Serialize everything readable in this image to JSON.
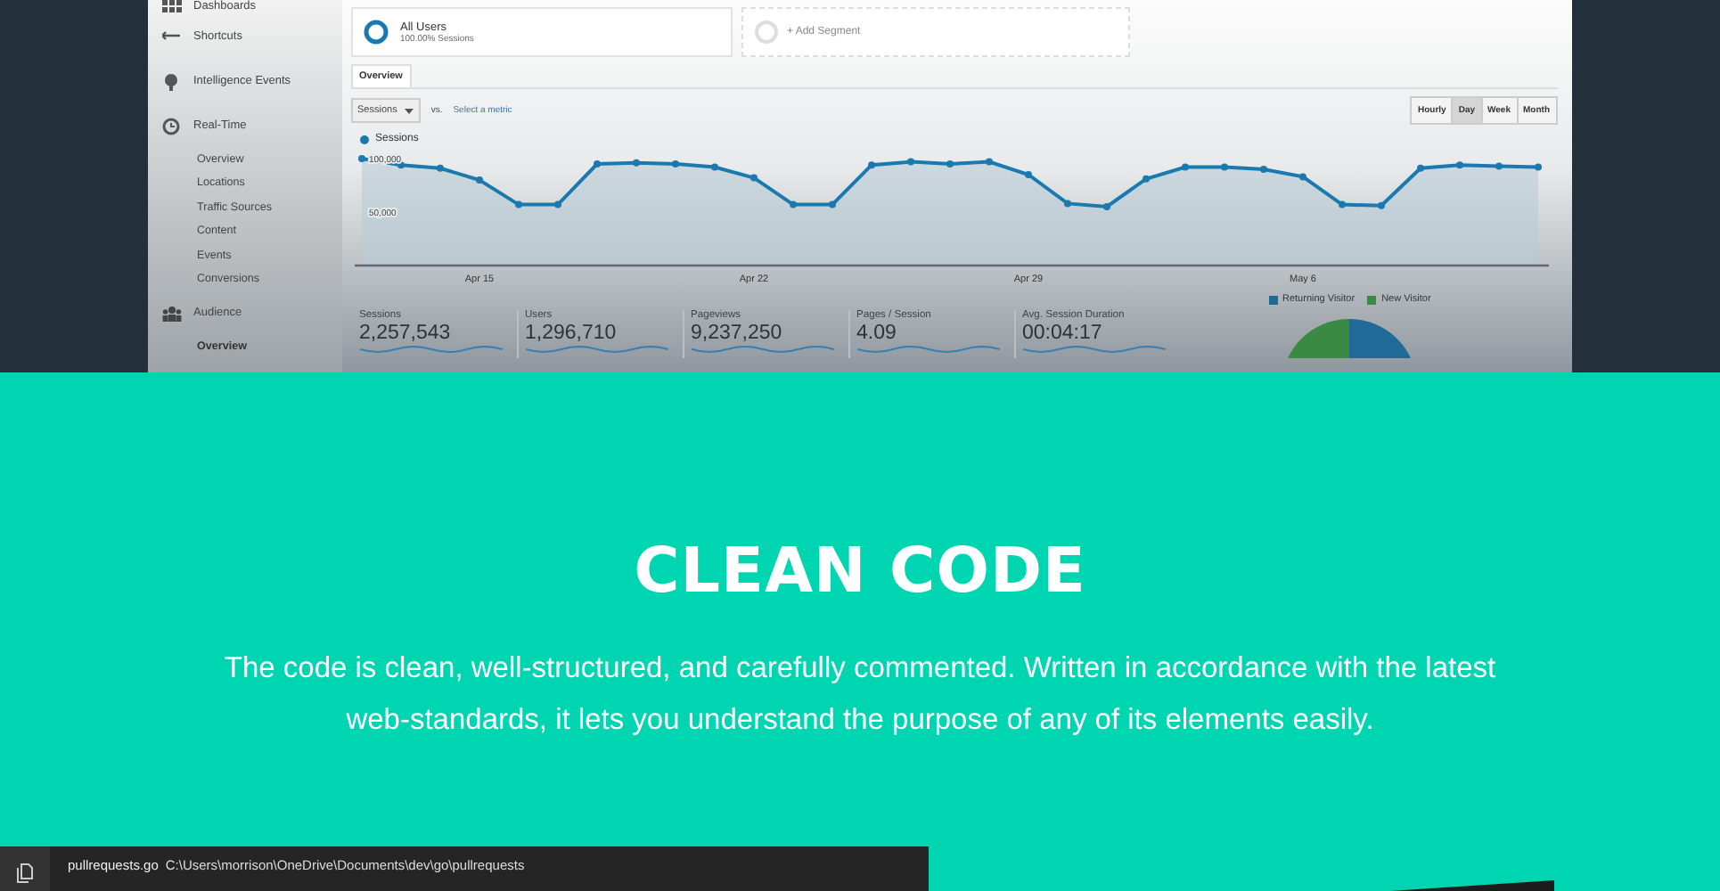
{
  "sidebar": {
    "items": [
      {
        "label": "Dashboards"
      },
      {
        "label": "Shortcuts"
      },
      {
        "label": "Intelligence Events"
      },
      {
        "label": "Real-Time",
        "children": [
          {
            "label": "Overview",
            "selected": false
          },
          {
            "label": "Locations",
            "selected": false
          },
          {
            "label": "Traffic Sources",
            "selected": false
          },
          {
            "label": "Content",
            "selected": false
          },
          {
            "label": "Events",
            "selected": false
          },
          {
            "label": "Conversions",
            "selected": false
          }
        ]
      },
      {
        "label": "Audience",
        "children": [
          {
            "label": "Overview",
            "selected": true
          }
        ]
      }
    ]
  },
  "segments": [
    {
      "title": "All Users",
      "subtitle": "100.00% Sessions"
    }
  ],
  "add_segment": "+ Add Segment",
  "tabs": [
    {
      "label": "Overview",
      "selected": true
    }
  ],
  "metric_picker": {
    "value": "Sessions",
    "vs": "vs.",
    "link": "Select a metric"
  },
  "interval_buttons": [
    {
      "label": "Hourly",
      "selected": false
    },
    {
      "label": "Day",
      "selected": true
    },
    {
      "label": "Week",
      "selected": false
    },
    {
      "label": "Month",
      "selected": false
    }
  ],
  "chart": {
    "chart_data": {
      "type": "area",
      "ylim": [
        0,
        100000
      ],
      "yticks": [
        {
          "value": 50000,
          "label": "50,000"
        },
        {
          "value": 100000,
          "label": "100,000"
        }
      ],
      "categories": [
        null,
        null,
        null,
        "Apr 15",
        null,
        null,
        null,
        null,
        null,
        null,
        "Apr 22",
        null,
        null,
        null,
        null,
        null,
        null,
        "Apr 29",
        null,
        null,
        null,
        null,
        null,
        null,
        "May 6",
        null,
        null,
        null,
        null,
        null,
        null
      ],
      "series": [
        {
          "name": "Sessions",
          "color": "#1a7ab0",
          "values": [
            100000,
            94000,
            91000,
            80000,
            57000,
            57000,
            95000,
            96000,
            95000,
            92000,
            82000,
            57000,
            57000,
            94000,
            97000,
            95000,
            97000,
            85000,
            58000,
            55000,
            81000,
            92000,
            92000,
            90000,
            83000,
            57000,
            56000,
            91000,
            94000,
            93000,
            92000
          ]
        }
      ]
    }
  },
  "metrics": [
    {
      "label": "Sessions",
      "value": "2,257,543"
    },
    {
      "label": "Users",
      "value": "1,296,710"
    },
    {
      "label": "Pageviews",
      "value": "9,237,250"
    },
    {
      "label": "Pages / Session",
      "value": "4.09"
    },
    {
      "label": "Avg. Session Duration",
      "value": "00:04:17"
    }
  ],
  "pie_legend": [
    {
      "label": "Returning Visitor",
      "color": "#1f6a96"
    },
    {
      "label": "New Visitor",
      "color": "#3b8a44"
    }
  ],
  "feature": {
    "title": "CLEAN CODE",
    "text": "The code is clean, well-structured, and carefully commented. Written in accordance with the latest web-standards, it lets you understand the purpose of any of its elements easily."
  },
  "editor": {
    "file": "pullrequests.go",
    "path": "C:\\Users\\morrison\\OneDrive\\Documents\\dev\\go\\pullrequests"
  }
}
